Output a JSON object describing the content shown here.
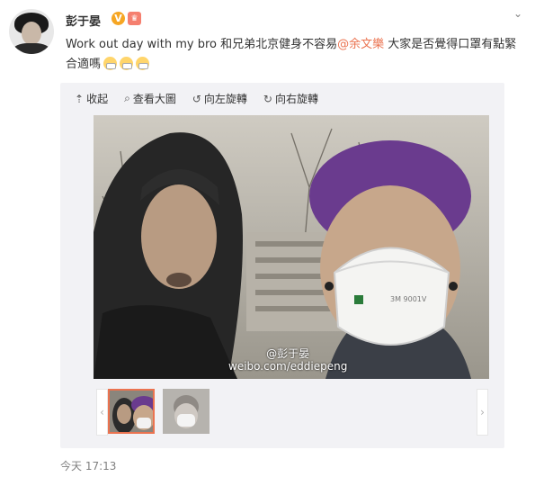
{
  "post": {
    "username": "彭于晏",
    "text_before": "Work out day with my bro 和兄弟北京健身不容易",
    "mention": "@余文樂",
    "text_after": " 大家是否覺得口罩有點緊 合適嗎",
    "emoji_count": 3,
    "timestamp": "今天 17:13"
  },
  "media_toolbar": {
    "collapse": "收起",
    "view_large": "查看大圖",
    "rotate_left": "向左旋轉",
    "rotate_right": "向右旋轉"
  },
  "photo": {
    "watermark_user": "@彭于晏",
    "watermark_url": "weibo.com/eddiepeng",
    "mask_label": "3M 9001V"
  },
  "thumbnails": {
    "count": 2,
    "active_index": 0
  },
  "colors": {
    "accent": "#eb7350",
    "badge_v": "#f6a623",
    "media_bg": "#f2f2f5",
    "meta_text": "#808080"
  }
}
